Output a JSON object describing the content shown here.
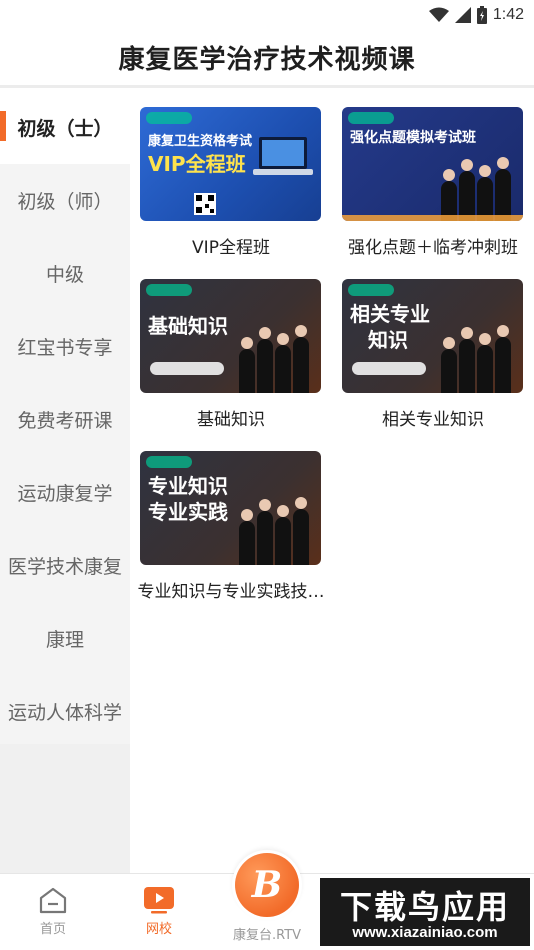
{
  "status_bar": {
    "time": "1:42"
  },
  "header": {
    "title": "康复医学治疗技术视频课"
  },
  "sidebar": {
    "items": [
      {
        "label": "初级（士）",
        "active": true
      },
      {
        "label": "初级（师）",
        "active": false
      },
      {
        "label": "中级",
        "active": false
      },
      {
        "label": "红宝书专享",
        "active": false
      },
      {
        "label": "免费考研课",
        "active": false
      },
      {
        "label": "运动康复学",
        "active": false
      },
      {
        "label": "医学技术康复",
        "active": false
      },
      {
        "label": "康理",
        "active": false
      },
      {
        "label": "运动人体科学",
        "active": false
      }
    ]
  },
  "courses": [
    {
      "caption": "VIP全程班",
      "thumb_lines": [
        "康复卫生资格考试",
        "VIP全程班"
      ]
    },
    {
      "caption": "强化点题＋临考冲刺班",
      "thumb_lines": [
        "强化点题模拟考试班"
      ]
    },
    {
      "caption": "基础知识",
      "thumb_lines": [
        "基础知识"
      ]
    },
    {
      "caption": "相关专业知识",
      "thumb_lines": [
        "相关专业",
        "知识"
      ]
    },
    {
      "caption": "专业知识与专业实践技…",
      "thumb_lines": [
        "专业知识",
        "专业实践"
      ]
    }
  ],
  "bottom_nav": {
    "home": "首页",
    "courses": "网校",
    "center": "康复台.RTV"
  },
  "watermark": {
    "title": "下载鸟应用",
    "url": "www.xiazainiao.com"
  },
  "colors": {
    "accent": "#f26b29",
    "sidebar_bg": "#f4f4f4"
  }
}
